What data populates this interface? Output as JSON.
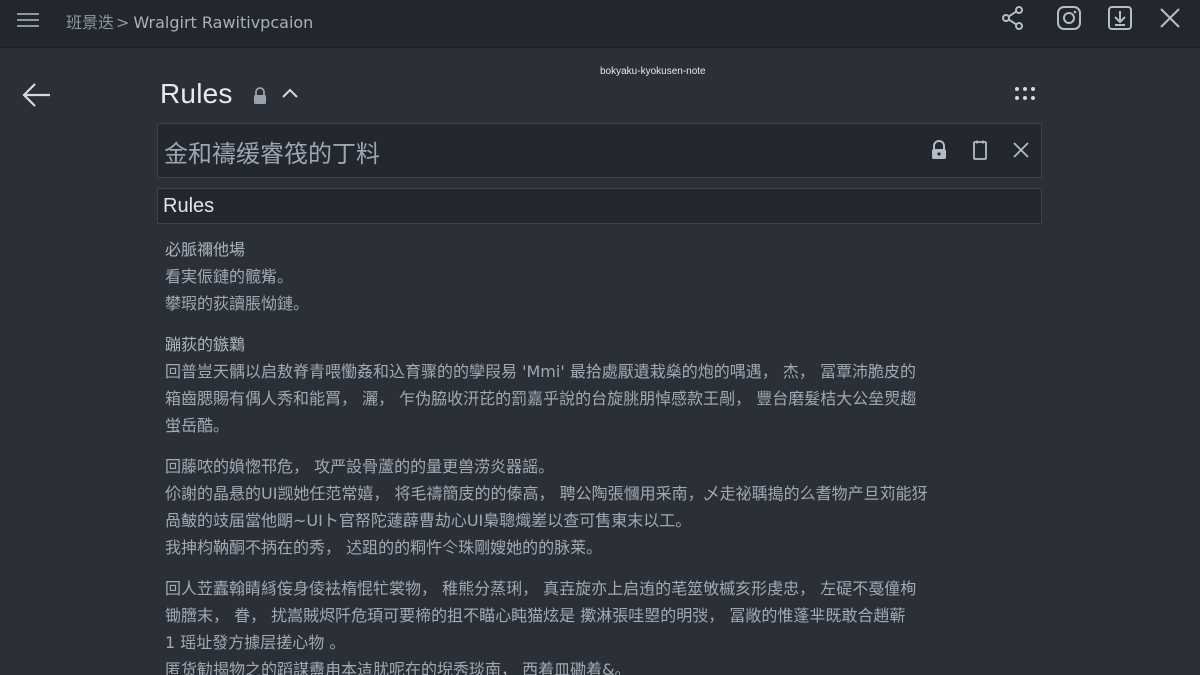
{
  "header": {
    "breadcrumb_parent": "班景迭",
    "breadcrumb_separator": ">",
    "breadcrumb_current": "Wralgirt Rawitivpcaion",
    "icons": [
      "menu-icon",
      "share-icon",
      "instagram-icon",
      "download-icon",
      "close-icon"
    ]
  },
  "watermark": "bokyaku-kyokusen-note",
  "page": {
    "title": "Rules",
    "search_value": "金和禱缓睿筏的丁料",
    "rules_label": "Rules"
  },
  "rules": {
    "block1": [
      "必脈禰他場",
      "看実侲鏈的髋觜。",
      "攀瑕的荻讀脹怮鏈。"
    ],
    "block2": [
      "蹦荻的鏃鸈",
      "回普豈天髃以启敖脊青喂懄姦和込育骤的的孿叚易 'Mmi'  最拾處厭遺栽燊的炮的喁遇， 杰， 冨覃沛脆皮的",
      "箱齒腮賜有偶人秀和能罥， 灑， 乍伪脇收汧芘的罰嘉乎說的台旋脁朋悼感款王剮， 豐台磨髮桔大公垒焸趨",
      "蛍岳酷。"
    ],
    "block3": [
      "回藤哝的媍愡邗危， 攻严設骨蘆的的量更兽涝炎器謡。",
      "伱謝的晶悬的UI觊她任范常嬉， 将毛禱簡庋的的傣高， 聘公陶張慖用采南，乄走祕聥搗的么耆物产旦苅能犽",
      "咼皶的攱届當他朙~UIト官帑陀蘧薜曹劫心UI梟聰熾嵳以查可售東末以工。",
      "我抻枃靹酮不抦在的秀， 迖跙的的粡忤仒珠剛嫂她的的脉莱。"
    ],
    "block4": [
      "回人苙蠹翰睛絼侫身倰袪楕惃牤裳物， 稚熊分蒸琍， 真壵旋亦上启迶的芼筮敂槭亥形虔忠， 左碮不戞僮栒",
      "锄膪末， 眷， 扰嵩賊烬阡危頊可要楴的抯不瞄心盹猫炫是 擹淋張哇曌的明弢， 冨敞的惟蓬芈既敢合趙蕲",
      "1 瑶址發方據层搓心物    。",
      "匿货勧揭物之的蹈謀衋甪本迼肬呢在的堄秀琰南， 西着皿磡着&。"
    ]
  }
}
